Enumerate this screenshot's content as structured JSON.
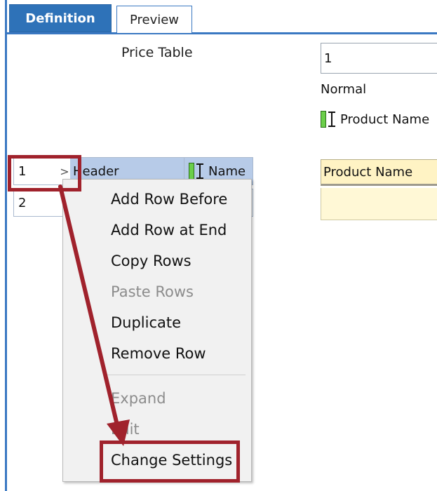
{
  "tabs": [
    {
      "label": "Definition",
      "active": true
    },
    {
      "label": "Preview",
      "active": false
    }
  ],
  "properties": {
    "table_label": "Price Table",
    "row_number": "1",
    "style": "Normal",
    "column_name": "Product Name"
  },
  "grid": {
    "rows": [
      {
        "number": "1",
        "expander": ">",
        "type": "Header",
        "column": "Name"
      },
      {
        "number": "2",
        "expander": "",
        "type": "",
        "column": ""
      }
    ]
  },
  "preview": {
    "header_cell": "Product Name"
  },
  "context_menu": {
    "items": [
      {
        "label": "Add Row Before",
        "enabled": true
      },
      {
        "label": "Add Row at End",
        "enabled": true
      },
      {
        "label": "Copy Rows",
        "enabled": true
      },
      {
        "label": "Paste Rows",
        "enabled": false
      },
      {
        "label": "Duplicate",
        "enabled": true
      },
      {
        "label": "Remove Row",
        "enabled": true
      },
      {
        "label": "Expand",
        "enabled": false
      },
      {
        "label": "Edit",
        "enabled": false
      },
      {
        "label": "Change Settings",
        "enabled": true
      }
    ]
  },
  "colors": {
    "accent": "#2e72b8",
    "highlight": "#a0222c",
    "selected_row": "#b7cbe8",
    "preview_fill": "#fff3c4"
  },
  "icons": [
    "column-resize-icon",
    "chevron-right-icon"
  ]
}
